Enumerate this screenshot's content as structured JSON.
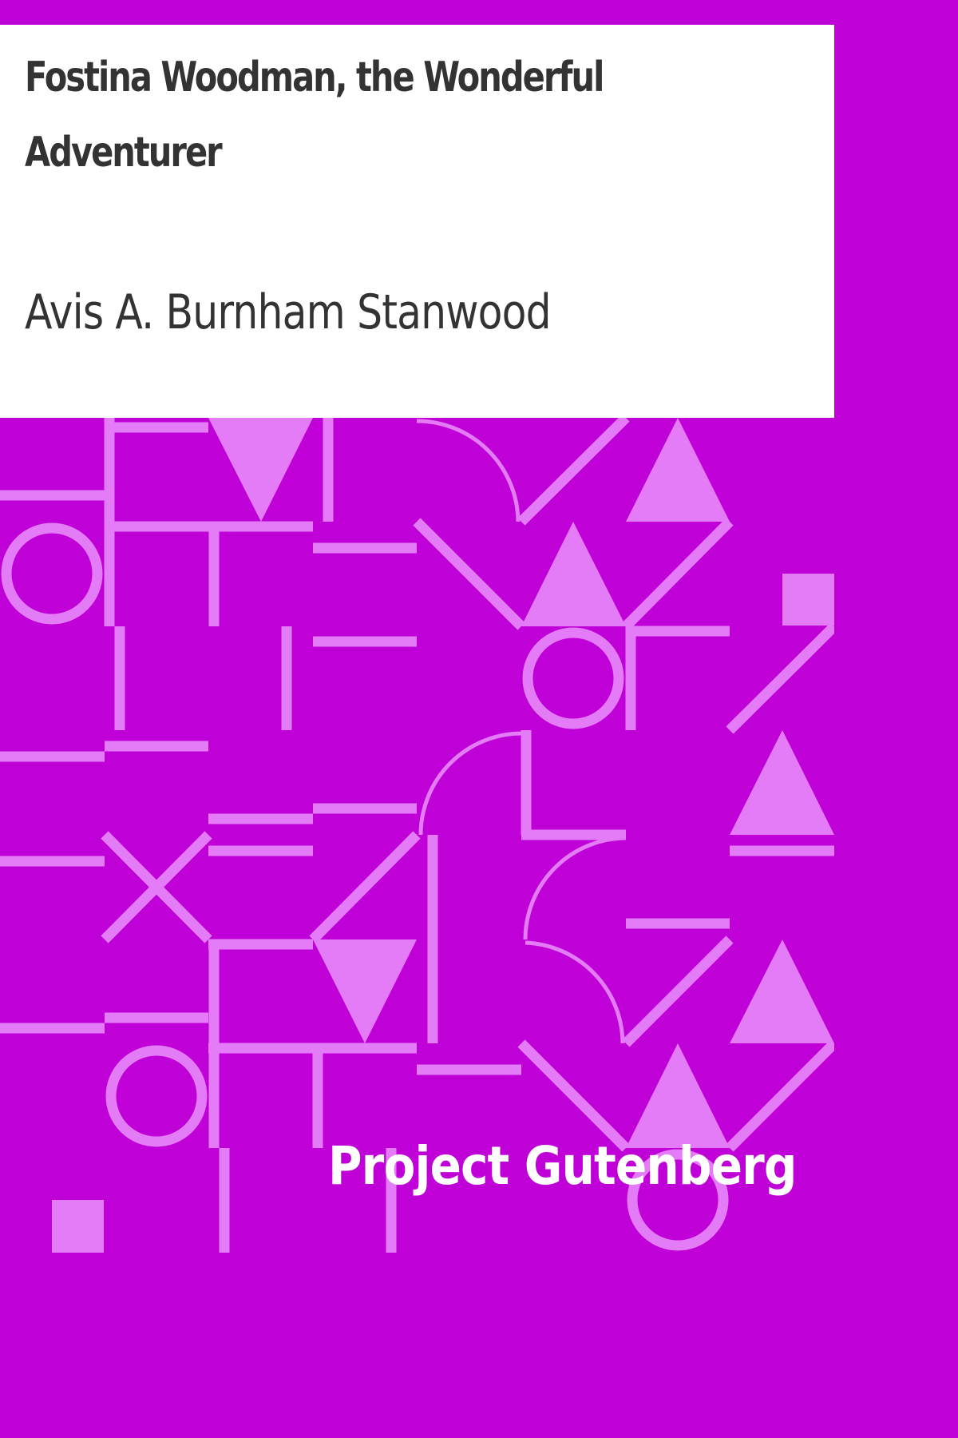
{
  "cover": {
    "title": "Fostina Woodman, the Wonderful Adventurer",
    "author": "Avis A. Burnham Stanwood",
    "publisher": "Project Gutenberg"
  },
  "colors": {
    "background": "#bf00d7",
    "pattern": "#e47cf8",
    "panel": "#ffffff",
    "text_dark": "#333333",
    "text_light": "#ffffff"
  }
}
